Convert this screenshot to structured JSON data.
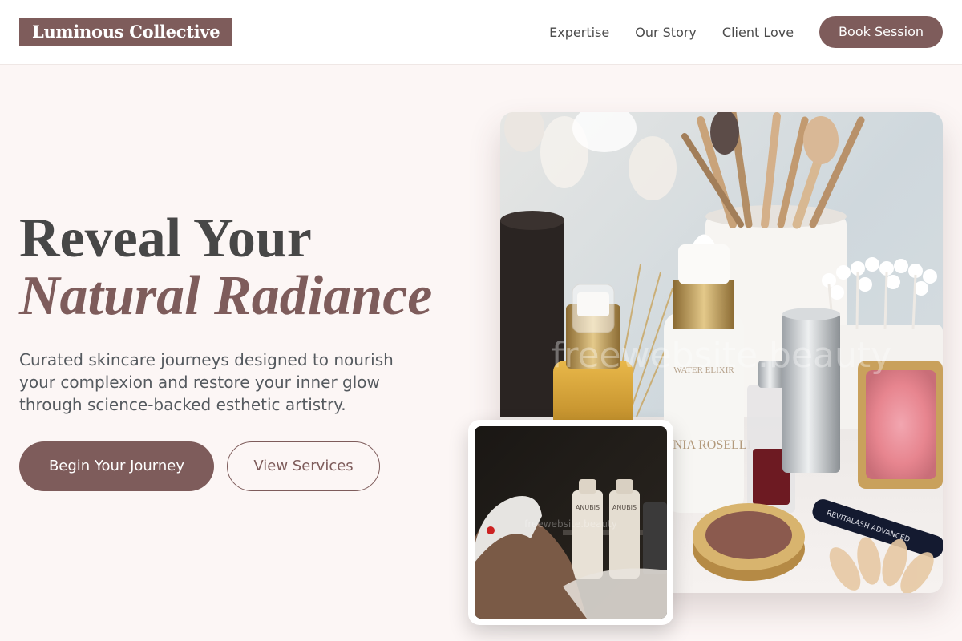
{
  "brand": {
    "name": "Luminous Collective"
  },
  "nav": {
    "links": [
      "Expertise",
      "Our Story",
      "Client Love"
    ],
    "cta": "Book Session"
  },
  "hero": {
    "title_line1": "Reveal Your",
    "title_line2": "Natural Radiance",
    "subtitle": "Curated skincare journeys designed to nourish your complexion and restore your inner glow through science-backed esthetic artistry.",
    "primary_button": "Begin Your Journey",
    "secondary_button": "View Services"
  },
  "images": {
    "main": {
      "watermark": "freewebsite.beauty",
      "bottle_label": "SONIA ROSELLI",
      "serum_label": "WATER ELIXIR",
      "mascara_label": "REVITALASH ADVANCED"
    },
    "inset": {
      "watermark": "freewebsite.beauty",
      "bottle_label_1": "ANUBIS",
      "bottle_label_2": "ANUBIS"
    }
  },
  "colors": {
    "accent": "#7e5c5b",
    "background": "#fcf6f5",
    "header_bg": "#ffffff",
    "text": "#474747"
  }
}
